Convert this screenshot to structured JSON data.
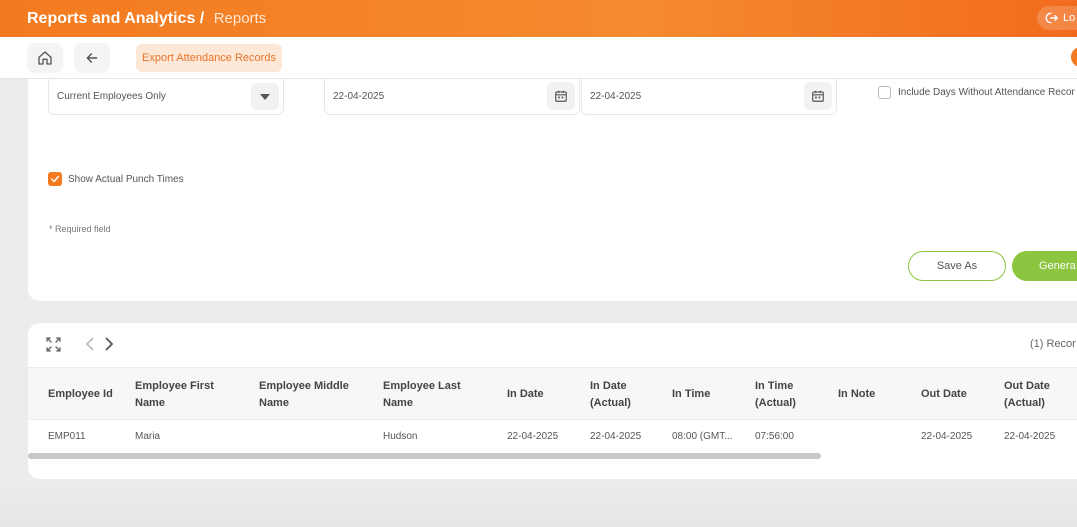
{
  "header": {
    "title": "Reports and Analytics",
    "separator": " / ",
    "crumb": "Reports",
    "logout_label": "Lo"
  },
  "toolbar": {
    "export_label": "Export Attendance Records"
  },
  "form": {
    "employee_filter": "Current Employees Only",
    "start_date": "22-04-2025",
    "end_date": "22-04-2025",
    "include_days_label": "Include Days Without Attendance Recor",
    "include_days_checked": false,
    "show_punch_label": "Show Actual Punch Times",
    "show_punch_checked": true,
    "required_note": "* Required field",
    "save_as_label": "Save As",
    "generate_label": "Genera"
  },
  "results": {
    "record_count": "(1) Recor",
    "columns": [
      "Employee Id",
      "Employee First Name",
      "Employee Middle Name",
      "Employee Last Name",
      "In Date",
      "In Date (Actual)",
      "In Time",
      "In Time (Actual)",
      "In Note",
      "Out Date",
      "Out Date (Actual)"
    ],
    "rows": [
      [
        "EMP011",
        "Maria",
        "",
        "Hudson",
        "22-04-2025",
        "22-04-2025",
        "08:00 (GMT...",
        "07:56:00",
        "",
        "22-04-2025",
        "22-04-2025"
      ]
    ]
  },
  "colors": {
    "accent": "#f47a1f",
    "primary_green": "#8cc53f"
  }
}
